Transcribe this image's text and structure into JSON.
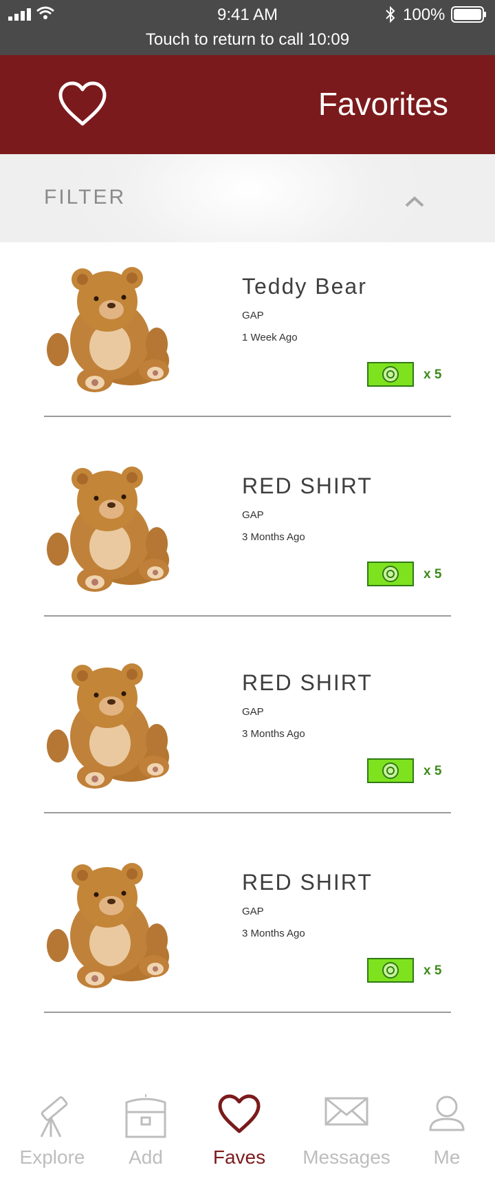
{
  "status_bar": {
    "time": "9:41 AM",
    "battery": "100%",
    "call_banner": "Touch to return to call 10:09"
  },
  "header": {
    "title": "Favorites",
    "icon": "heart-icon"
  },
  "filter": {
    "label": "FILTER",
    "icon": "chevron-up-icon"
  },
  "items": [
    {
      "name": "Teddy Bear",
      "brand": "GAP",
      "time": "1 Week Ago",
      "count": "x 5"
    },
    {
      "name": "RED SHIRT",
      "brand": "GAP",
      "time": "3 Months Ago",
      "count": "x 5"
    },
    {
      "name": "RED SHIRT",
      "brand": "GAP",
      "time": "3 Months Ago",
      "count": "x 5"
    },
    {
      "name": "RED SHIRT",
      "brand": "GAP",
      "time": "3 Months Ago",
      "count": "x 5"
    }
  ],
  "tabs": [
    {
      "label": "Explore",
      "icon": "telescope-icon"
    },
    {
      "label": "Add",
      "icon": "treasure-chest-icon"
    },
    {
      "label": "Faves",
      "icon": "heart-icon",
      "active": true
    },
    {
      "label": "Messages",
      "icon": "envelope-icon"
    },
    {
      "label": "Me",
      "icon": "person-icon"
    }
  ],
  "colors": {
    "brand": "#7b1a1c",
    "money": "#7ee21f",
    "count_text": "#3d8a1c",
    "inactive_tab": "#bdbdbd"
  }
}
